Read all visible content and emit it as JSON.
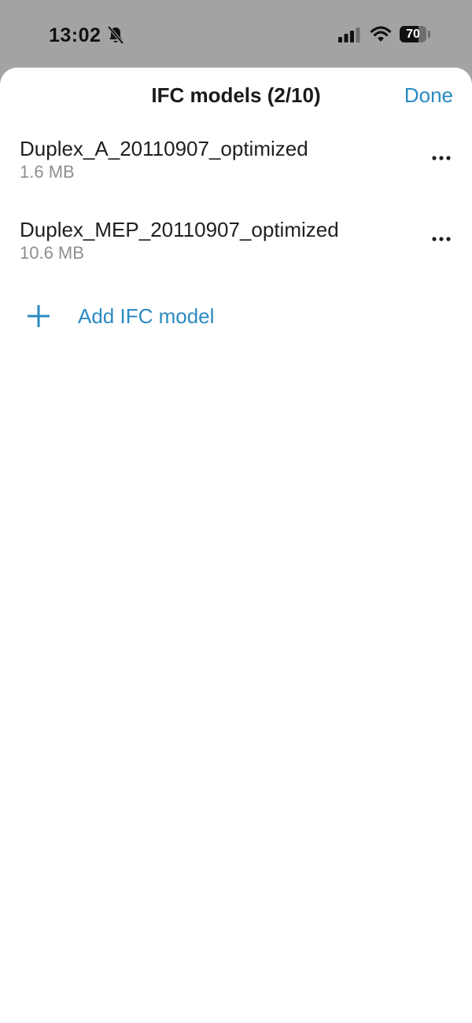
{
  "status_bar": {
    "time": "13:02",
    "battery_level": "70",
    "battery_fraction": 0.7
  },
  "icons": {
    "bell": "bell-slash-icon",
    "signal": "cellular-signal-icon",
    "wifi": "wifi-icon",
    "more": "ellipsis-icon",
    "add": "plus-icon"
  },
  "sheet": {
    "title": "IFC models (2/10)",
    "done_label": "Done"
  },
  "models": [
    {
      "name": "Duplex_A_20110907_optimized",
      "size": "1.6 MB"
    },
    {
      "name": "Duplex_MEP_20110907_optimized",
      "size": "10.6 MB"
    }
  ],
  "add_model_label": "Add IFC model",
  "colors": {
    "accent": "#2a8ac2",
    "status_bar_bg": "#a3a3a3",
    "secondary_text": "#8e8e8e"
  }
}
